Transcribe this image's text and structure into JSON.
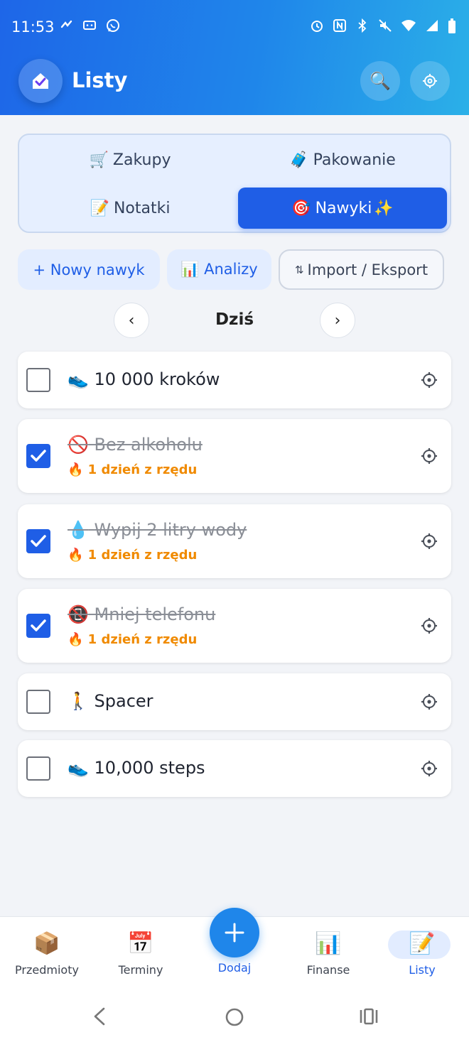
{
  "status_bar": {
    "time": "11:53",
    "left_icons": [
      "messenger-icon",
      "chat-icon",
      "viber-icon"
    ],
    "right_icons": [
      "alarm-icon",
      "nfc-icon",
      "bluetooth-icon",
      "mute-icon",
      "wifi-icon",
      "signal-icon",
      "battery-icon"
    ]
  },
  "header": {
    "title": "Listy",
    "search_icon": "🔍"
  },
  "tabs": [
    {
      "emoji": "🛒",
      "label": "Zakupy",
      "active": false
    },
    {
      "emoji": "🧳",
      "label": "Pakowanie",
      "active": false
    },
    {
      "emoji": "📝",
      "label": "Notatki",
      "active": false
    },
    {
      "emoji": "🎯",
      "label": "Nawyki",
      "suffix": "✨",
      "active": true
    }
  ],
  "actions": {
    "new_habit": "+ Nowy nawyk",
    "analytics": "📊 Analizy",
    "import_export_icon": "⇅",
    "import_export": "Import / Eksport"
  },
  "day_nav": {
    "prev": "‹",
    "label": "Dziś",
    "next": "›"
  },
  "habits": [
    {
      "emoji": "👟",
      "title": "10 000 kroków",
      "checked": false,
      "streak": ""
    },
    {
      "emoji": "🚫",
      "title": "Bez alkoholu",
      "checked": true,
      "streak": "🔥 1 dzień z rzędu"
    },
    {
      "emoji": "💧",
      "title": "Wypij 2 litry wody",
      "checked": true,
      "streak": "🔥 1 dzień z rzędu"
    },
    {
      "emoji": "📵",
      "title": "Mniej telefonu",
      "checked": true,
      "streak": "🔥 1 dzień z rzędu"
    },
    {
      "emoji": "🚶",
      "title": "Spacer",
      "checked": false,
      "streak": ""
    },
    {
      "emoji": "👟",
      "title": "10,000 steps",
      "checked": false,
      "streak": ""
    }
  ],
  "bottom_nav": [
    {
      "icon": "📦",
      "label": "Przedmioty",
      "active": false
    },
    {
      "icon": "📅",
      "label": "Terminy",
      "active": false
    },
    {
      "icon": "📊",
      "label": "Finanse",
      "active": false
    },
    {
      "icon": "📝",
      "label": "Listy",
      "active": true
    }
  ],
  "fab": {
    "label": "Dodaj"
  },
  "colors": {
    "primary": "#1f5ee6",
    "header_gradient_start": "#1e66e8",
    "header_gradient_end": "#2bb0e8",
    "streak": "#f08a00"
  }
}
